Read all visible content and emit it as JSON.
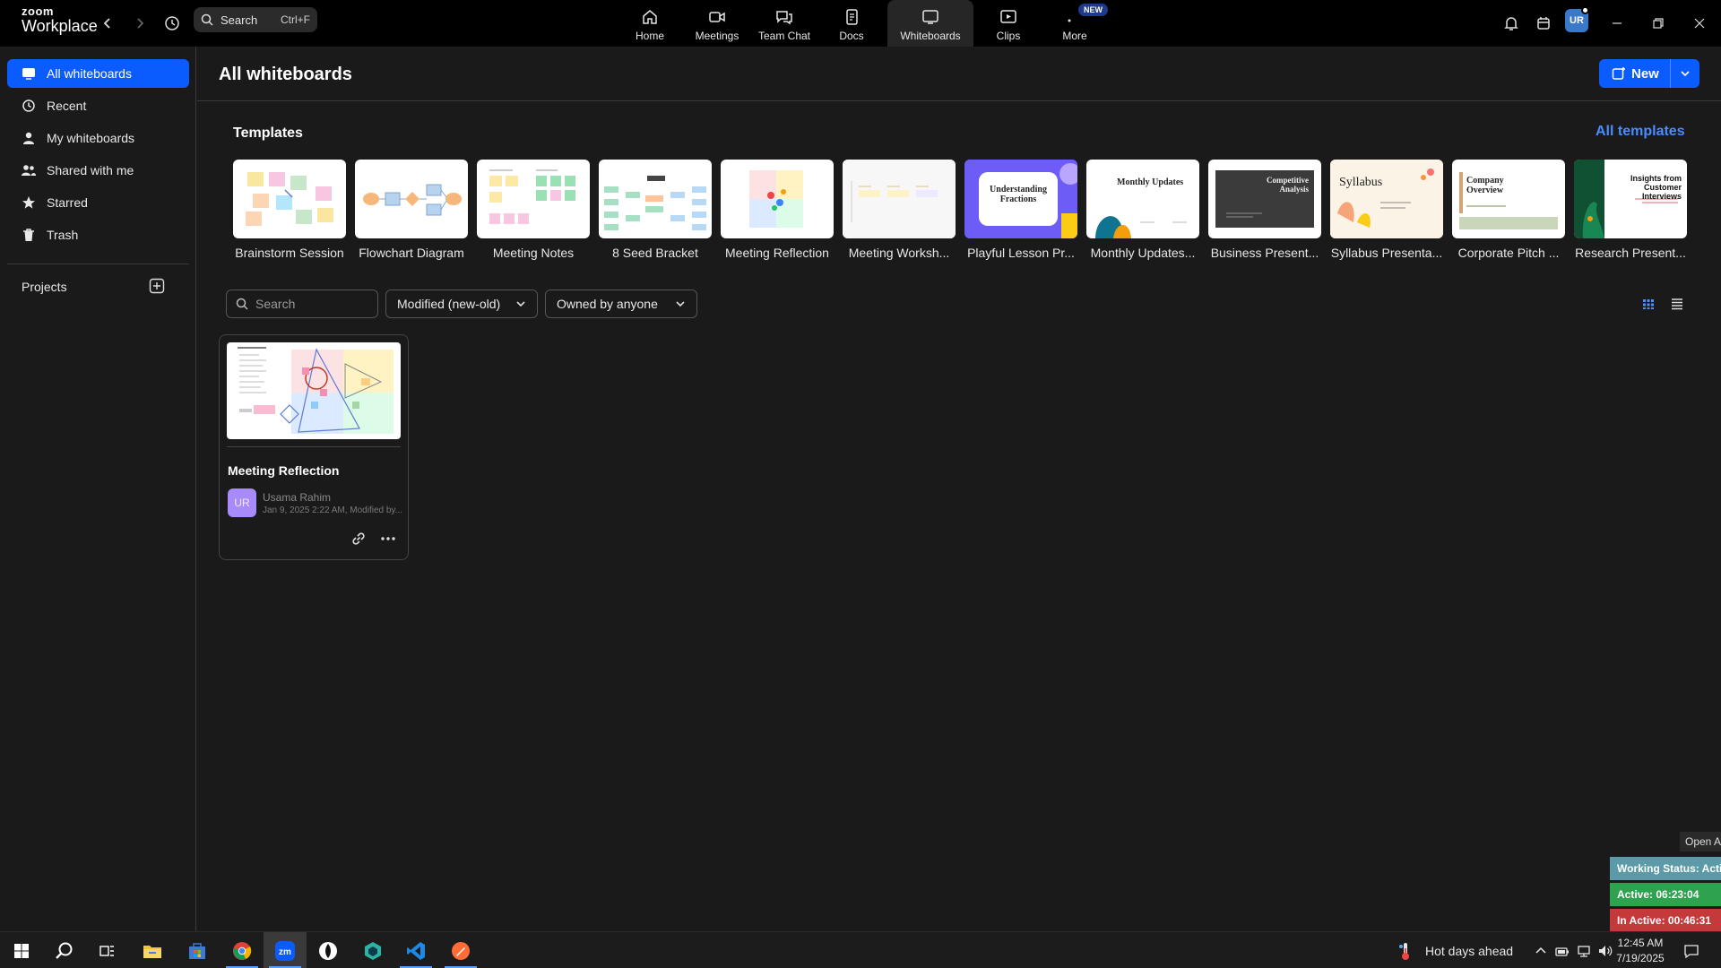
{
  "app": {
    "brand_top": "zoom",
    "brand_bottom": "Workplace"
  },
  "topbar": {
    "search_label": "Search",
    "search_shortcut": "Ctrl+F",
    "tabs": [
      {
        "label": "Home",
        "icon": "home-icon"
      },
      {
        "label": "Meetings",
        "icon": "video-camera-icon"
      },
      {
        "label": "Team Chat",
        "icon": "chat-bubble-icon"
      },
      {
        "label": "Docs",
        "icon": "document-icon"
      },
      {
        "label": "Whiteboards",
        "icon": "whiteboard-icon",
        "active": true
      },
      {
        "label": "Clips",
        "icon": "clips-icon"
      },
      {
        "label": "More",
        "icon": "more-dots-icon",
        "badge": "NEW"
      }
    ],
    "avatar_initials": "UR"
  },
  "sidebar": {
    "items": [
      {
        "label": "All whiteboards",
        "icon": "whiteboard-icon",
        "active": true
      },
      {
        "label": "Recent",
        "icon": "history-icon"
      },
      {
        "label": "My whiteboards",
        "icon": "person-icon"
      },
      {
        "label": "Shared with me",
        "icon": "people-icon"
      },
      {
        "label": "Starred",
        "icon": "star-icon"
      },
      {
        "label": "Trash",
        "icon": "trash-icon"
      }
    ],
    "projects_label": "Projects"
  },
  "main": {
    "title": "All whiteboards",
    "new_button": "New",
    "templates_title": "Templates",
    "all_templates_link": "All templates",
    "templates": [
      {
        "label": "Brainstorm Session"
      },
      {
        "label": "Flowchart Diagram"
      },
      {
        "label": "Meeting Notes"
      },
      {
        "label": "8 Seed Bracket"
      },
      {
        "label": "Meeting Reflection"
      },
      {
        "label": "Meeting Worksh..."
      },
      {
        "label": "Playful Lesson Pr...",
        "thumb_text": "Understanding Fractions"
      },
      {
        "label": "Monthly Updates...",
        "thumb_text": "Monthly Updates"
      },
      {
        "label": "Business Present...",
        "thumb_text": "Competitive Analysis"
      },
      {
        "label": "Syllabus Presenta...",
        "thumb_text": "Syllabus"
      },
      {
        "label": "Corporate Pitch ...",
        "thumb_text": "Company Overview"
      },
      {
        "label": "Research Present...",
        "thumb_text": "Insights from Customer Interviews"
      }
    ],
    "filters": {
      "search_placeholder": "Search",
      "sort_value": "Modified (new-old)",
      "owner_value": "Owned by anyone"
    },
    "cards": [
      {
        "title": "Meeting Reflection",
        "owner_initials": "UR",
        "owner": "Usama Rahim",
        "meta": "Jan 9, 2025 2:22 AM, Modified by..."
      }
    ]
  },
  "status_widget": {
    "open_label": "Open A",
    "working_status": "Working Status: Acti",
    "active": "Active: 06:23:04",
    "inactive": "In Active: 00:46:31"
  },
  "taskbar": {
    "weather": "Hot days ahead",
    "time": "12:45 AM",
    "date": "7/19/2025"
  },
  "colors": {
    "accent": "#0b5cff",
    "link": "#4a8dff",
    "working_status_bg": "#5b9aa6",
    "active_bg": "#2ea24f",
    "inactive_bg": "#c43a3a"
  }
}
